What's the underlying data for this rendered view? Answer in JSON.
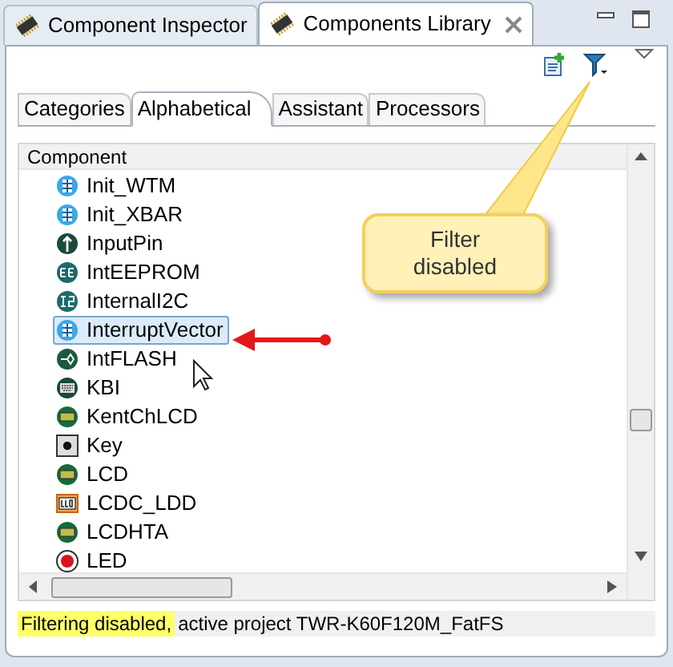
{
  "view_tabs": [
    {
      "label": "Component Inspector",
      "selected": false
    },
    {
      "label": "Components Library",
      "selected": true
    }
  ],
  "sub_tabs": [
    {
      "label": "Categories",
      "selected": false
    },
    {
      "label": "Alphabetical",
      "selected": true
    },
    {
      "label": "Assistant",
      "selected": false
    },
    {
      "label": "Processors",
      "selected": false
    }
  ],
  "tree": {
    "header": "Component",
    "rows": [
      {
        "label": "Init_WTM",
        "kind": "grid",
        "selected": false
      },
      {
        "label": "Init_XBAR",
        "kind": "grid",
        "selected": false
      },
      {
        "label": "InputPin",
        "kind": "pin",
        "selected": false
      },
      {
        "label": "IntEEPROM",
        "kind": "ee",
        "selected": false
      },
      {
        "label": "InternalI2C",
        "kind": "i2c",
        "selected": false
      },
      {
        "label": "InterruptVector",
        "kind": "grid",
        "selected": true
      },
      {
        "label": "IntFLASH",
        "kind": "flash",
        "selected": false
      },
      {
        "label": "KBI",
        "kind": "keyboard",
        "selected": false
      },
      {
        "label": "KentChLCD",
        "kind": "lcd",
        "selected": false
      },
      {
        "label": "Key",
        "kind": "key",
        "selected": false
      },
      {
        "label": "LCD",
        "kind": "lcd",
        "selected": false
      },
      {
        "label": "LCDC_LDD",
        "kind": "lcdbox",
        "selected": false
      },
      {
        "label": "LCDHTA",
        "kind": "lcd",
        "selected": false
      },
      {
        "label": "LED",
        "kind": "led",
        "selected": false
      }
    ]
  },
  "callout": {
    "text": "Filter disabled"
  },
  "status_bar": [
    {
      "text": "Filtering disabled,",
      "highlighted": true
    },
    {
      "text": "active project TWR-K60F120M_FatFS",
      "highlighted": false
    }
  ]
}
